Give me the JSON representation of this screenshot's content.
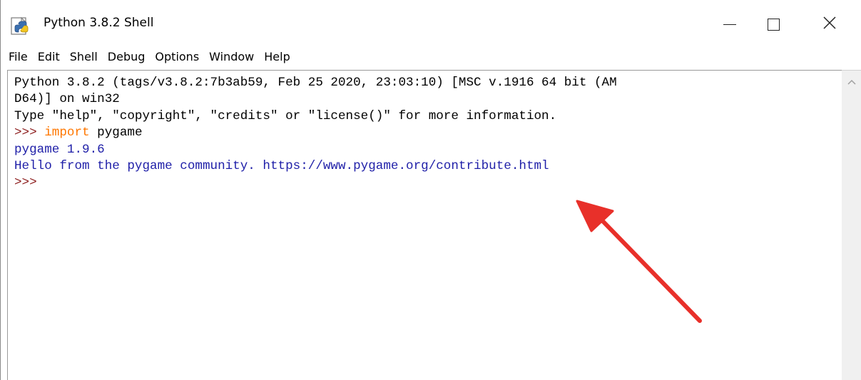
{
  "window": {
    "title": "Python 3.8.2 Shell",
    "icon": "python-idle-icon",
    "controls": {
      "minimize_icon": "minimize-icon",
      "maximize_icon": "maximize-icon",
      "close_icon": "close-icon",
      "close_glyph": "✕"
    }
  },
  "menu": {
    "items": [
      "File",
      "Edit",
      "Shell",
      "Debug",
      "Options",
      "Window",
      "Help"
    ]
  },
  "shell": {
    "banner_line1": "Python 3.8.2 (tags/v3.8.2:7b3ab59, Feb 25 2020, 23:03:10) [MSC v.1916 64 bit (AM",
    "banner_line2": "D64)] on win32",
    "banner_line3": "Type \"help\", \"copyright\", \"credits\" or \"license()\" for more information.",
    "prompt1": ">>> ",
    "input1_keyword": "import",
    "input1_rest": " pygame",
    "output1": "pygame 1.9.6",
    "output2": "Hello from the pygame community. https://www.pygame.org/contribute.html",
    "prompt2": ">>>"
  },
  "annotation": {
    "arrow_icon": "red-arrow-icon",
    "color": "#e8302a"
  },
  "colors": {
    "prompt": "#8b1a1a",
    "keyword": "#ff7700",
    "stdout": "#1f1fa8",
    "text": "#000000"
  }
}
